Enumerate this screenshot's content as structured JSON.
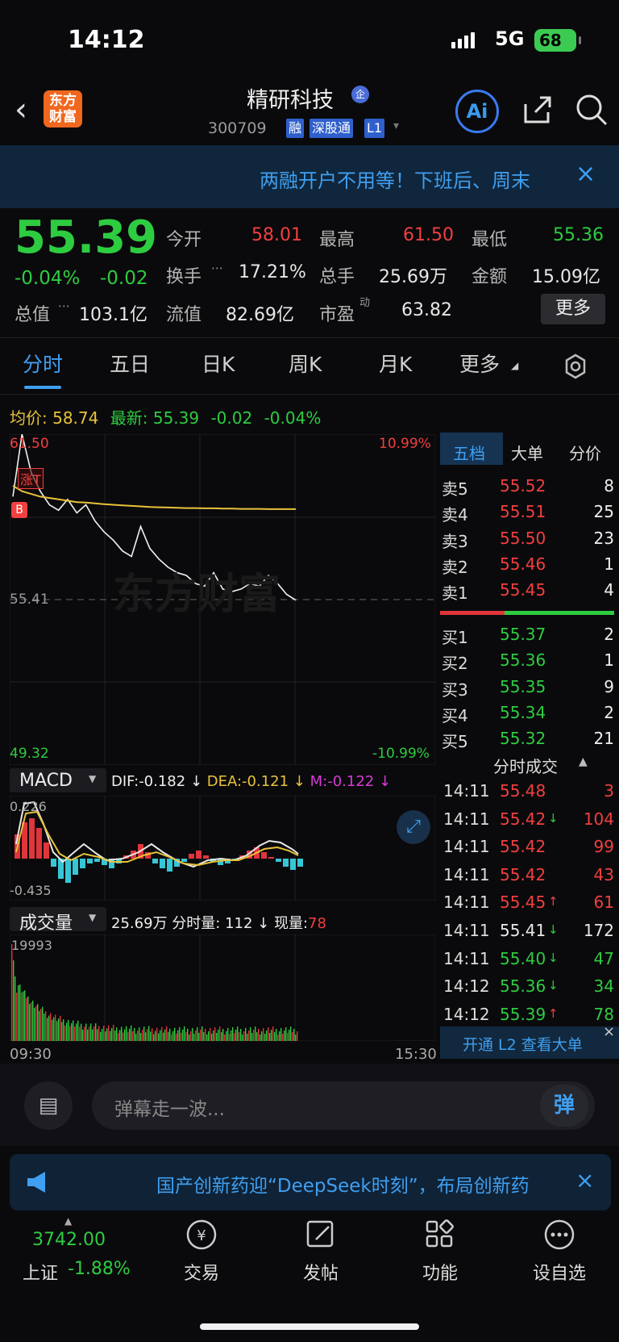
{
  "status_bar": {
    "time": "14:12",
    "network": "5G",
    "battery": "68"
  },
  "header": {
    "back_icon": "chevron-left-icon",
    "logo_text": "东方财富",
    "stock_name": "精研科技",
    "badge": "企",
    "code": "300709",
    "tags": [
      "融",
      "深股通",
      "L1"
    ],
    "ai_label": "Ai"
  },
  "banner": {
    "text": "两融开户不用等！下班后、周末",
    "close": "×"
  },
  "quote": {
    "price": "55.39",
    "change_pct": "-0.04%",
    "change": "-0.02",
    "stats": [
      {
        "label": "今开",
        "value": "58.01"
      },
      {
        "label": "最高",
        "value": "61.50"
      },
      {
        "label": "最低",
        "value": "55.36"
      },
      {
        "label": "换手",
        "value": "17.21%"
      },
      {
        "label": "总手",
        "value": "25.69万"
      },
      {
        "label": "金额",
        "value": "15.09亿"
      },
      {
        "label": "总值",
        "value": "103.1亿"
      },
      {
        "label": "流值",
        "value": "82.69亿"
      },
      {
        "label": "市盈",
        "sup": "动",
        "value": "63.82"
      }
    ],
    "more_label": "更多"
  },
  "tabs": [
    "分时",
    "五日",
    "日K",
    "周K",
    "月K",
    "更多"
  ],
  "info_line": {
    "avg_label": "均价:",
    "avg": "58.74",
    "latest_label": "最新:",
    "latest": "55.39",
    "chg": "-0.02",
    "pct": "-0.04%"
  },
  "chart": {
    "top_price": "61.50",
    "mid_price": "55.41",
    "bottom_price": "49.32",
    "top_pct": "10.99%",
    "bottom_pct": "-10.99%",
    "mark_t": "涨T",
    "mark_b": "B",
    "watermark": "东方财富",
    "start_time": "09:30",
    "end_time": "15:30"
  },
  "chart_data": {
    "type": "line",
    "series": [
      {
        "name": "最新",
        "values": [
          59.2,
          61.5,
          60.1,
          59.4,
          58.9,
          58.7,
          59.1,
          58.6,
          58.9,
          58.3,
          57.9,
          57.6,
          57.2,
          57.0,
          58.1,
          57.3,
          56.9,
          56.6,
          56.4,
          56.3,
          56.0,
          55.9,
          56.4,
          55.8,
          55.7,
          55.8,
          56.0,
          55.9,
          56.3,
          56.0,
          55.6,
          55.39
        ]
      },
      {
        "name": "均价",
        "values": [
          59.6,
          59.4,
          59.3,
          59.2,
          59.15,
          59.1,
          59.05,
          59.0,
          58.98,
          58.95,
          58.92,
          58.9,
          58.88,
          58.86,
          58.84,
          58.82,
          58.81,
          58.8,
          58.79,
          58.78,
          58.78,
          58.77,
          58.77,
          58.76,
          58.76,
          58.75,
          58.75,
          58.75,
          58.74,
          58.74,
          58.74,
          58.74
        ]
      }
    ],
    "ylim": [
      49.32,
      61.5
    ]
  },
  "macd": {
    "label": "MACD",
    "dif": "DIF:-0.182",
    "dea": "DEA:-0.121",
    "m": "M:-0.122",
    "top": "0.226",
    "bottom": "-0.435"
  },
  "volume": {
    "label": "成交量",
    "total": "25.69万",
    "minute_label": "分时量:",
    "minute": "112",
    "now_label": "现量:",
    "now": "78",
    "max": "19993"
  },
  "order_book": {
    "tabs": [
      "五档",
      "大单",
      "分价"
    ],
    "sells": [
      {
        "label": "卖5",
        "price": "55.52",
        "vol": "8"
      },
      {
        "label": "卖4",
        "price": "55.51",
        "vol": "25"
      },
      {
        "label": "卖3",
        "price": "55.50",
        "vol": "23"
      },
      {
        "label": "卖2",
        "price": "55.46",
        "vol": "1"
      },
      {
        "label": "卖1",
        "price": "55.45",
        "vol": "4"
      }
    ],
    "buys": [
      {
        "label": "买1",
        "price": "55.37",
        "vol": "2"
      },
      {
        "label": "买2",
        "price": "55.36",
        "vol": "1"
      },
      {
        "label": "买3",
        "price": "55.35",
        "vol": "9"
      },
      {
        "label": "买4",
        "price": "55.34",
        "vol": "2"
      },
      {
        "label": "买5",
        "price": "55.32",
        "vol": "21"
      }
    ]
  },
  "ticks": {
    "title": "分时成交",
    "rows": [
      {
        "time": "14:11",
        "price": "55.48",
        "arrow": "",
        "vol": "3",
        "color": "red"
      },
      {
        "time": "14:11",
        "price": "55.42",
        "arrow": "↓",
        "vol": "104",
        "color": "red"
      },
      {
        "time": "14:11",
        "price": "55.42",
        "arrow": "",
        "vol": "99",
        "color": "red"
      },
      {
        "time": "14:11",
        "price": "55.42",
        "arrow": "",
        "vol": "43",
        "color": "red"
      },
      {
        "time": "14:11",
        "price": "55.45",
        "arrow": "↑",
        "vol": "61",
        "color": "red"
      },
      {
        "time": "14:11",
        "price": "55.41",
        "arrow": "↓",
        "vol": "172",
        "color": "white"
      },
      {
        "time": "14:11",
        "price": "55.40",
        "arrow": "↓",
        "vol": "47",
        "color": "green"
      },
      {
        "time": "14:12",
        "price": "55.36",
        "arrow": "↓",
        "vol": "34",
        "color": "green"
      },
      {
        "time": "14:12",
        "price": "55.39",
        "arrow": "↑",
        "vol": "78",
        "color": "green"
      }
    ],
    "l2_label": "开通 L2 查看大单"
  },
  "danmu": {
    "placeholder": "弹幕走一波...",
    "send_label": "弹"
  },
  "news": {
    "text": "国产创新药迎“DeepSeek时刻”，布局创新药"
  },
  "bottom_nav": {
    "index_value": "3742.00",
    "index_name": "上证",
    "index_pct": "-1.88%",
    "items": [
      {
        "label": "交易",
        "icon": "yen-icon"
      },
      {
        "label": "发帖",
        "icon": "edit-icon"
      },
      {
        "label": "功能",
        "icon": "grid-icon"
      },
      {
        "label": "设自选",
        "icon": "more-icon"
      }
    ]
  }
}
